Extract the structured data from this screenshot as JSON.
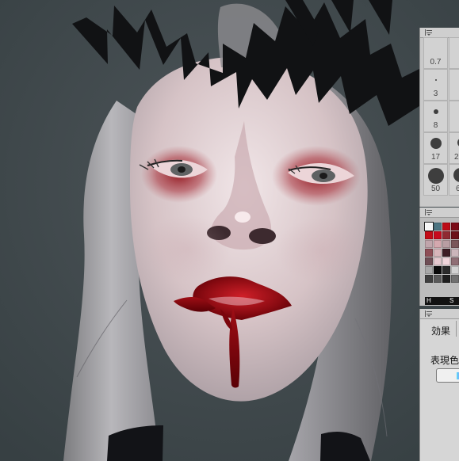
{
  "panels": {
    "brush": {
      "labels": [
        "0.7",
        "3",
        "8",
        "17",
        "50",
        "2",
        "6"
      ]
    },
    "colors": {
      "h_label": "H",
      "s_label": "S"
    },
    "effect": {
      "title": "効果",
      "label": "表現色"
    }
  },
  "icons": {
    "panel_menu": "panel-menu-icon"
  }
}
